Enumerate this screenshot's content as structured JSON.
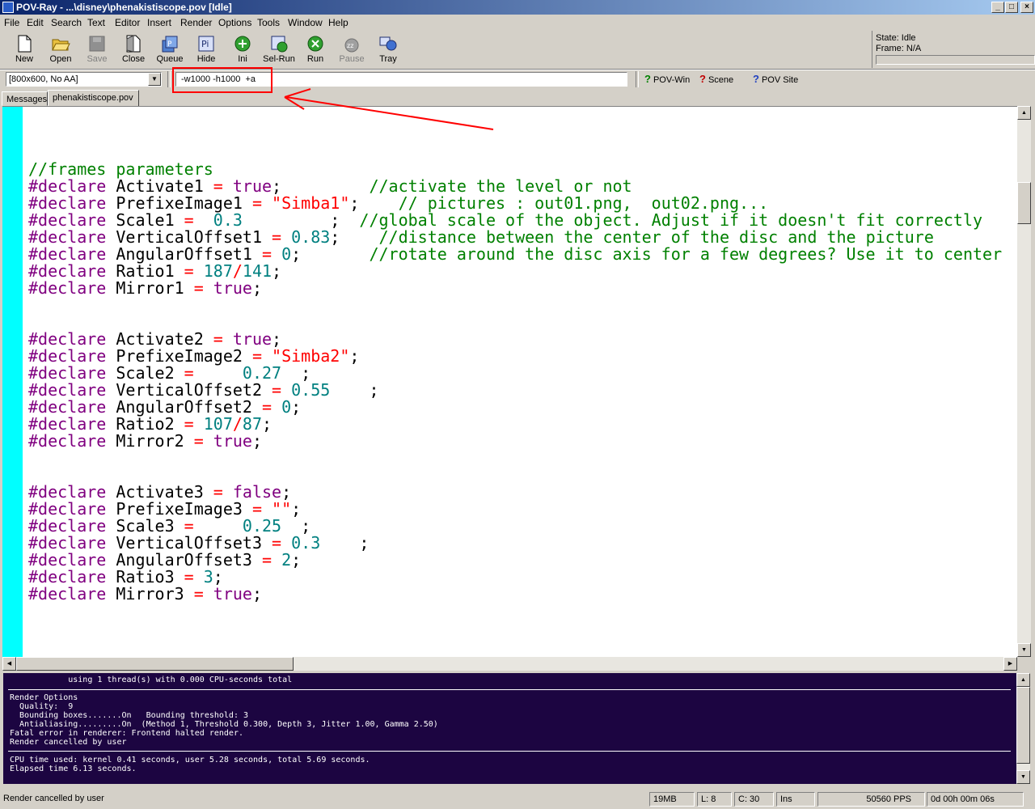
{
  "window": {
    "title": "POV-Ray - ...\\disney\\phenakistiscope.pov [Idle]",
    "controls": {
      "minimize": "_",
      "maximize": "□",
      "close": "×"
    }
  },
  "menu": [
    "File",
    "Edit",
    "Search",
    "Text",
    "Editor",
    "Insert",
    "Render",
    "Options",
    "Tools",
    "Window",
    "Help"
  ],
  "toolbar": [
    {
      "label": "New",
      "icon": "new-file-icon",
      "enabled": true
    },
    {
      "label": "Open",
      "icon": "open-folder-icon",
      "enabled": true
    },
    {
      "label": "Save",
      "icon": "save-icon",
      "enabled": false
    },
    {
      "label": "Close",
      "icon": "close-doc-icon",
      "enabled": true
    },
    {
      "label": "Queue",
      "icon": "queue-icon",
      "enabled": true
    },
    {
      "label": "Hide",
      "icon": "hide-icon",
      "enabled": true
    },
    {
      "label": "Ini",
      "icon": "ini-icon",
      "enabled": true
    },
    {
      "label": "Sel-Run",
      "icon": "sel-run-icon",
      "enabled": true
    },
    {
      "label": "Run",
      "icon": "run-icon",
      "enabled": true
    },
    {
      "label": "Pause",
      "icon": "pause-icon",
      "enabled": false
    },
    {
      "label": "Tray",
      "icon": "tray-icon",
      "enabled": true
    }
  ],
  "status_panel": {
    "state": "State:  Idle",
    "frame": "Frame: N/A"
  },
  "render_toolbar": {
    "resolution": "[800x600, No AA]",
    "command_line": "-w1000 -h1000  +a",
    "links": [
      {
        "label": "POV-Win",
        "icon": "help-icon"
      },
      {
        "label": "Scene",
        "icon": "help-icon"
      },
      {
        "label": "POV Site",
        "icon": "help-icon"
      }
    ]
  },
  "tabs": [
    {
      "label": "Messages",
      "active": false
    },
    {
      "label": "phenakistiscope.pov",
      "active": true
    }
  ],
  "editor": {
    "lines": [
      [
        [
          "c",
          "//frames parameters"
        ]
      ],
      [
        [
          "k",
          "#declare"
        ],
        [
          "p",
          " Activate1 "
        ],
        [
          "o",
          "="
        ],
        [
          "p",
          " "
        ],
        [
          "k",
          "true"
        ],
        [
          "p",
          ";         "
        ],
        [
          "c",
          "//activate the level or not"
        ]
      ],
      [
        [
          "k",
          "#declare"
        ],
        [
          "p",
          " PrefixeImage1 "
        ],
        [
          "o",
          "="
        ],
        [
          "p",
          " "
        ],
        [
          "s",
          "\"Simba1\""
        ],
        [
          "p",
          ";    "
        ],
        [
          "c",
          "// pictures : out01.png,  out02.png..."
        ]
      ],
      [
        [
          "k",
          "#declare"
        ],
        [
          "p",
          " Scale1 "
        ],
        [
          "o",
          "="
        ],
        [
          "p",
          "  "
        ],
        [
          "n",
          "0.3"
        ],
        [
          "p",
          "         ;  "
        ],
        [
          "c",
          "//global scale of the object. Adjust if it doesn't fit correctly"
        ]
      ],
      [
        [
          "k",
          "#declare"
        ],
        [
          "p",
          " VerticalOffset1 "
        ],
        [
          "o",
          "="
        ],
        [
          "p",
          " "
        ],
        [
          "n",
          "0.83"
        ],
        [
          "p",
          ";    "
        ],
        [
          "c",
          "//distance between the center of the disc and the picture"
        ]
      ],
      [
        [
          "k",
          "#declare"
        ],
        [
          "p",
          " AngularOffset1 "
        ],
        [
          "o",
          "="
        ],
        [
          "p",
          " "
        ],
        [
          "n",
          "0"
        ],
        [
          "p",
          ";       "
        ],
        [
          "c",
          "//rotate around the disc axis for a few degrees? Use it to center"
        ]
      ],
      [
        [
          "k",
          "#declare"
        ],
        [
          "p",
          " Ratio1 "
        ],
        [
          "o",
          "="
        ],
        [
          "p",
          " "
        ],
        [
          "n",
          "187"
        ],
        [
          "o",
          "/"
        ],
        [
          "n",
          "141"
        ],
        [
          "p",
          ";"
        ]
      ],
      [
        [
          "k",
          "#declare"
        ],
        [
          "p",
          " Mirror1 "
        ],
        [
          "o",
          "="
        ],
        [
          "p",
          " "
        ],
        [
          "k",
          "true"
        ],
        [
          "p",
          ";"
        ]
      ],
      [],
      [],
      [
        [
          "k",
          "#declare"
        ],
        [
          "p",
          " Activate2 "
        ],
        [
          "o",
          "="
        ],
        [
          "p",
          " "
        ],
        [
          "k",
          "true"
        ],
        [
          "p",
          ";"
        ]
      ],
      [
        [
          "k",
          "#declare"
        ],
        [
          "p",
          " PrefixeImage2 "
        ],
        [
          "o",
          "="
        ],
        [
          "p",
          " "
        ],
        [
          "s",
          "\"Simba2\""
        ],
        [
          "p",
          ";"
        ]
      ],
      [
        [
          "k",
          "#declare"
        ],
        [
          "p",
          " Scale2 "
        ],
        [
          "o",
          "="
        ],
        [
          "p",
          "     "
        ],
        [
          "n",
          "0.27"
        ],
        [
          "p",
          "  ;"
        ]
      ],
      [
        [
          "k",
          "#declare"
        ],
        [
          "p",
          " VerticalOffset2 "
        ],
        [
          "o",
          "="
        ],
        [
          "p",
          " "
        ],
        [
          "n",
          "0.55"
        ],
        [
          "p",
          "    ;"
        ]
      ],
      [
        [
          "k",
          "#declare"
        ],
        [
          "p",
          " AngularOffset2 "
        ],
        [
          "o",
          "="
        ],
        [
          "p",
          " "
        ],
        [
          "n",
          "0"
        ],
        [
          "p",
          ";"
        ]
      ],
      [
        [
          "k",
          "#declare"
        ],
        [
          "p",
          " Ratio2 "
        ],
        [
          "o",
          "="
        ],
        [
          "p",
          " "
        ],
        [
          "n",
          "107"
        ],
        [
          "o",
          "/"
        ],
        [
          "n",
          "87"
        ],
        [
          "p",
          ";"
        ]
      ],
      [
        [
          "k",
          "#declare"
        ],
        [
          "p",
          " Mirror2 "
        ],
        [
          "o",
          "="
        ],
        [
          "p",
          " "
        ],
        [
          "k",
          "true"
        ],
        [
          "p",
          ";"
        ]
      ],
      [],
      [],
      [
        [
          "k",
          "#declare"
        ],
        [
          "p",
          " Activate3 "
        ],
        [
          "o",
          "="
        ],
        [
          "p",
          " "
        ],
        [
          "k",
          "false"
        ],
        [
          "p",
          ";"
        ]
      ],
      [
        [
          "k",
          "#declare"
        ],
        [
          "p",
          " PrefixeImage3 "
        ],
        [
          "o",
          "="
        ],
        [
          "p",
          " "
        ],
        [
          "s",
          "\"\""
        ],
        [
          "p",
          ";"
        ]
      ],
      [
        [
          "k",
          "#declare"
        ],
        [
          "p",
          " Scale3 "
        ],
        [
          "o",
          "="
        ],
        [
          "p",
          "     "
        ],
        [
          "n",
          "0.25"
        ],
        [
          "p",
          "  ;"
        ]
      ],
      [
        [
          "k",
          "#declare"
        ],
        [
          "p",
          " VerticalOffset3 "
        ],
        [
          "o",
          "="
        ],
        [
          "p",
          " "
        ],
        [
          "n",
          "0.3"
        ],
        [
          "p",
          "    ;"
        ]
      ],
      [
        [
          "k",
          "#declare"
        ],
        [
          "p",
          " AngularOffset3 "
        ],
        [
          "o",
          "="
        ],
        [
          "p",
          " "
        ],
        [
          "n",
          "2"
        ],
        [
          "p",
          ";"
        ]
      ],
      [
        [
          "k",
          "#declare"
        ],
        [
          "p",
          " Ratio3 "
        ],
        [
          "o",
          "="
        ],
        [
          "p",
          " "
        ],
        [
          "n",
          "3"
        ],
        [
          "p",
          ";"
        ]
      ],
      [
        [
          "k",
          "#declare"
        ],
        [
          "p",
          " Mirror3 "
        ],
        [
          "o",
          "="
        ],
        [
          "p",
          " "
        ],
        [
          "k",
          "true"
        ],
        [
          "p",
          ";"
        ]
      ]
    ]
  },
  "messages": {
    "top": "            using 1 thread(s) with 0.000 CPU-seconds total",
    "render_options": "Render Options\n  Quality:  9\n  Bounding boxes.......On   Bounding threshold: 3\n  Antialiasing.........On  (Method 1, Threshold 0.300, Depth 3, Jitter 1.00, Gamma 2.50)\nFatal error in renderer: Frontend halted render.\nRender cancelled by user",
    "timing": "CPU time used: kernel 0.41 seconds, user 5.28 seconds, total 5.69 seconds.\nElapsed time 6.13 seconds."
  },
  "statusbar": {
    "message": "Render cancelled by user",
    "memory": "19MB",
    "line": "L: 8",
    "column": "C: 30",
    "mode": "Ins",
    "pps": "50560 PPS",
    "elapsed": "0d 00h 00m 06s"
  },
  "colors": {
    "annotation": "#ff0000",
    "message_bg": "#1c0541",
    "gutter": "#00ffff"
  }
}
